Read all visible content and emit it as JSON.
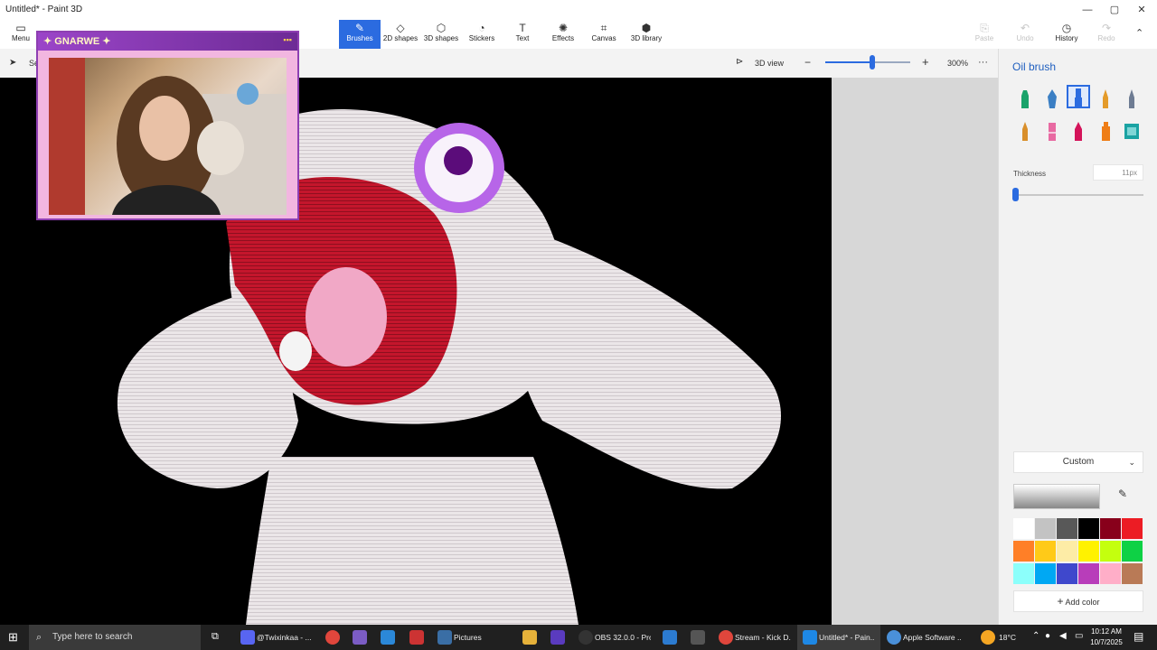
{
  "window": {
    "title": "Untitled* - Paint 3D",
    "minimize": "—",
    "maximize": "▢",
    "close": "✕"
  },
  "ribbon": {
    "menu": "Menu",
    "tabs": [
      {
        "label": "Brushes",
        "icon": "brush-icon",
        "glyph": "✎"
      },
      {
        "label": "2D shapes",
        "icon": "2d-shapes-icon",
        "glyph": "◇"
      },
      {
        "label": "3D shapes",
        "icon": "3d-shapes-icon",
        "glyph": "⬡"
      },
      {
        "label": "Stickers",
        "icon": "stickers-icon",
        "glyph": "◔"
      },
      {
        "label": "Text",
        "icon": "text-icon",
        "glyph": "T"
      },
      {
        "label": "Effects",
        "icon": "effects-icon",
        "glyph": "✺"
      },
      {
        "label": "Canvas",
        "icon": "canvas-icon",
        "glyph": "⌗"
      },
      {
        "label": "3D library",
        "icon": "3d-library-icon",
        "glyph": "⬢"
      }
    ],
    "right": [
      {
        "label": "Paste",
        "glyph": "⎘"
      },
      {
        "label": "Undo",
        "glyph": "↶"
      },
      {
        "label": "History",
        "glyph": "◷"
      },
      {
        "label": "Redo",
        "glyph": "↷"
      }
    ]
  },
  "toolbar": {
    "select_short": "Se",
    "view3d": "3D view",
    "zoom": "300%",
    "more": "···"
  },
  "panel": {
    "title": "Oil brush",
    "thickness_label": "Thickness",
    "thickness_value": "11px",
    "thickness_fraction": 0.0,
    "custom_label": "Custom",
    "add_color": "Add color",
    "brushes": [
      {
        "name": "marker-icon",
        "color": "#1aa36b"
      },
      {
        "name": "calligraphy-pen-icon",
        "color": "#3b7fc4"
      },
      {
        "name": "oil-brush-icon",
        "color": "#2b6be0"
      },
      {
        "name": "watercolor-icon",
        "color": "#e49b2a"
      },
      {
        "name": "pixel-pen-icon",
        "color": "#6e7c93"
      },
      {
        "name": "pencil-icon",
        "color": "#d98f2b"
      },
      {
        "name": "eraser-icon",
        "color": "#e86aa2"
      },
      {
        "name": "crayon-icon",
        "color": "#d4145a"
      },
      {
        "name": "spray-can-icon",
        "color": "#ef7d16"
      },
      {
        "name": "fill-icon",
        "color": "#1aa3a3"
      }
    ],
    "colors": [
      "#ffffff",
      "#c3c3c3",
      "#585858",
      "#000000",
      "#88001b",
      "#ec1c24",
      "#ff7f27",
      "#ffca18",
      "#fdeca6",
      "#fff200",
      "#c4ff0e",
      "#0ed145",
      "#8cfffb",
      "#00a8f3",
      "#3f48cc",
      "#b83dba",
      "#ffaec8",
      "#b97a56"
    ]
  },
  "webcam": {
    "title": "✦ GNARWE ✦"
  },
  "taskbar": {
    "search_placeholder": "Type here to search",
    "items": [
      "@Twixinkaa - ...",
      "Pictures",
      "OBS 32.0.0 - Pro...",
      "Stream - Kick D...",
      "Untitled* - Pain...",
      "Apple Software ..."
    ],
    "temp": "18°C",
    "time": "10:12 AM",
    "date": "10/7/2025"
  }
}
